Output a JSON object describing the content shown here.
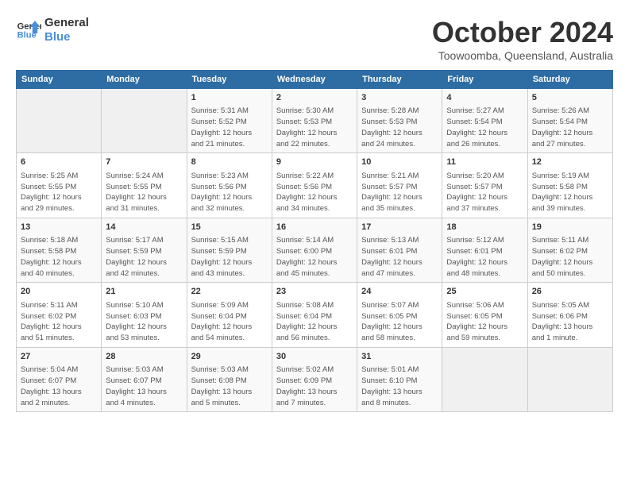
{
  "header": {
    "logo_line1": "General",
    "logo_line2": "Blue",
    "month": "October 2024",
    "location": "Toowoomba, Queensland, Australia"
  },
  "columns": [
    "Sunday",
    "Monday",
    "Tuesday",
    "Wednesday",
    "Thursday",
    "Friday",
    "Saturday"
  ],
  "weeks": [
    [
      {
        "num": "",
        "info": ""
      },
      {
        "num": "",
        "info": ""
      },
      {
        "num": "1",
        "info": "Sunrise: 5:31 AM\nSunset: 5:52 PM\nDaylight: 12 hours\nand 21 minutes."
      },
      {
        "num": "2",
        "info": "Sunrise: 5:30 AM\nSunset: 5:53 PM\nDaylight: 12 hours\nand 22 minutes."
      },
      {
        "num": "3",
        "info": "Sunrise: 5:28 AM\nSunset: 5:53 PM\nDaylight: 12 hours\nand 24 minutes."
      },
      {
        "num": "4",
        "info": "Sunrise: 5:27 AM\nSunset: 5:54 PM\nDaylight: 12 hours\nand 26 minutes."
      },
      {
        "num": "5",
        "info": "Sunrise: 5:26 AM\nSunset: 5:54 PM\nDaylight: 12 hours\nand 27 minutes."
      }
    ],
    [
      {
        "num": "6",
        "info": "Sunrise: 5:25 AM\nSunset: 5:55 PM\nDaylight: 12 hours\nand 29 minutes."
      },
      {
        "num": "7",
        "info": "Sunrise: 5:24 AM\nSunset: 5:55 PM\nDaylight: 12 hours\nand 31 minutes."
      },
      {
        "num": "8",
        "info": "Sunrise: 5:23 AM\nSunset: 5:56 PM\nDaylight: 12 hours\nand 32 minutes."
      },
      {
        "num": "9",
        "info": "Sunrise: 5:22 AM\nSunset: 5:56 PM\nDaylight: 12 hours\nand 34 minutes."
      },
      {
        "num": "10",
        "info": "Sunrise: 5:21 AM\nSunset: 5:57 PM\nDaylight: 12 hours\nand 35 minutes."
      },
      {
        "num": "11",
        "info": "Sunrise: 5:20 AM\nSunset: 5:57 PM\nDaylight: 12 hours\nand 37 minutes."
      },
      {
        "num": "12",
        "info": "Sunrise: 5:19 AM\nSunset: 5:58 PM\nDaylight: 12 hours\nand 39 minutes."
      }
    ],
    [
      {
        "num": "13",
        "info": "Sunrise: 5:18 AM\nSunset: 5:58 PM\nDaylight: 12 hours\nand 40 minutes."
      },
      {
        "num": "14",
        "info": "Sunrise: 5:17 AM\nSunset: 5:59 PM\nDaylight: 12 hours\nand 42 minutes."
      },
      {
        "num": "15",
        "info": "Sunrise: 5:15 AM\nSunset: 5:59 PM\nDaylight: 12 hours\nand 43 minutes."
      },
      {
        "num": "16",
        "info": "Sunrise: 5:14 AM\nSunset: 6:00 PM\nDaylight: 12 hours\nand 45 minutes."
      },
      {
        "num": "17",
        "info": "Sunrise: 5:13 AM\nSunset: 6:01 PM\nDaylight: 12 hours\nand 47 minutes."
      },
      {
        "num": "18",
        "info": "Sunrise: 5:12 AM\nSunset: 6:01 PM\nDaylight: 12 hours\nand 48 minutes."
      },
      {
        "num": "19",
        "info": "Sunrise: 5:11 AM\nSunset: 6:02 PM\nDaylight: 12 hours\nand 50 minutes."
      }
    ],
    [
      {
        "num": "20",
        "info": "Sunrise: 5:11 AM\nSunset: 6:02 PM\nDaylight: 12 hours\nand 51 minutes."
      },
      {
        "num": "21",
        "info": "Sunrise: 5:10 AM\nSunset: 6:03 PM\nDaylight: 12 hours\nand 53 minutes."
      },
      {
        "num": "22",
        "info": "Sunrise: 5:09 AM\nSunset: 6:04 PM\nDaylight: 12 hours\nand 54 minutes."
      },
      {
        "num": "23",
        "info": "Sunrise: 5:08 AM\nSunset: 6:04 PM\nDaylight: 12 hours\nand 56 minutes."
      },
      {
        "num": "24",
        "info": "Sunrise: 5:07 AM\nSunset: 6:05 PM\nDaylight: 12 hours\nand 58 minutes."
      },
      {
        "num": "25",
        "info": "Sunrise: 5:06 AM\nSunset: 6:05 PM\nDaylight: 12 hours\nand 59 minutes."
      },
      {
        "num": "26",
        "info": "Sunrise: 5:05 AM\nSunset: 6:06 PM\nDaylight: 13 hours\nand 1 minute."
      }
    ],
    [
      {
        "num": "27",
        "info": "Sunrise: 5:04 AM\nSunset: 6:07 PM\nDaylight: 13 hours\nand 2 minutes."
      },
      {
        "num": "28",
        "info": "Sunrise: 5:03 AM\nSunset: 6:07 PM\nDaylight: 13 hours\nand 4 minutes."
      },
      {
        "num": "29",
        "info": "Sunrise: 5:03 AM\nSunset: 6:08 PM\nDaylight: 13 hours\nand 5 minutes."
      },
      {
        "num": "30",
        "info": "Sunrise: 5:02 AM\nSunset: 6:09 PM\nDaylight: 13 hours\nand 7 minutes."
      },
      {
        "num": "31",
        "info": "Sunrise: 5:01 AM\nSunset: 6:10 PM\nDaylight: 13 hours\nand 8 minutes."
      },
      {
        "num": "",
        "info": ""
      },
      {
        "num": "",
        "info": ""
      }
    ]
  ]
}
